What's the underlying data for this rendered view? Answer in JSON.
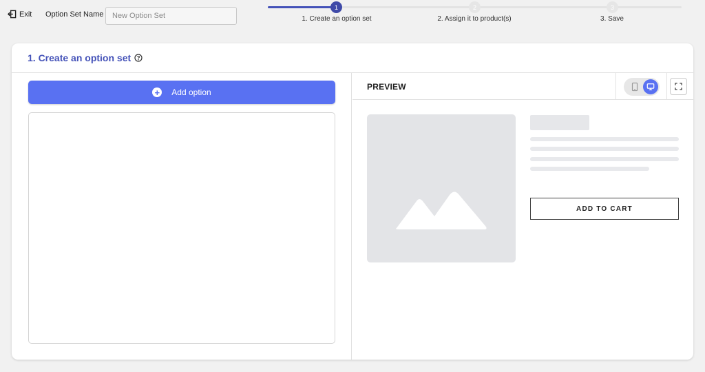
{
  "topbar": {
    "exit_label": "Exit",
    "name_label": "Option Set Name",
    "name_placeholder": "New Option Set",
    "name_value": ""
  },
  "stepper": {
    "steps": [
      {
        "number": "1",
        "label": "1. Create an option set",
        "state": "active"
      },
      {
        "number": "2",
        "label": "2. Assign it to product(s)",
        "state": "todo"
      },
      {
        "number": "3",
        "label": "3. Save",
        "state": "todo"
      }
    ]
  },
  "card": {
    "title": "1. Create an option set",
    "add_option_label": "Add option"
  },
  "preview": {
    "title": "PREVIEW",
    "add_to_cart_label": "ADD TO CART",
    "selected_device": "desktop"
  },
  "icons": {
    "exit": "exit-icon",
    "help": "help-circle-icon",
    "plus": "plus-circle-icon",
    "mobile": "mobile-icon",
    "desktop": "desktop-icon",
    "fullscreen": "fullscreen-icon",
    "image": "image-placeholder-icon"
  },
  "colors": {
    "accent": "#4452b8",
    "button_blue": "#5971f2",
    "background": "#f1f1f1"
  }
}
